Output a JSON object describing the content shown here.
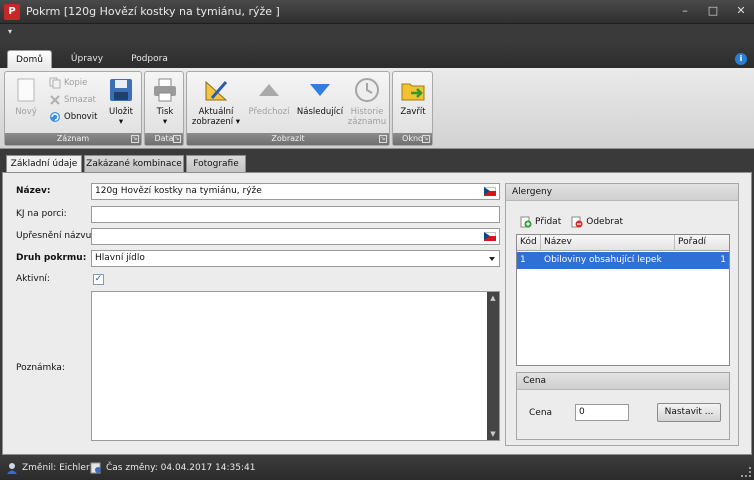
{
  "window": {
    "title": "Pokrm [120g Hovězí kostky na tymiánu, rýže ]",
    "app_icon": "app-logo-icon",
    "controls": [
      "–",
      "□",
      "✕"
    ]
  },
  "quick_access": {
    "menu_glyph": "▾"
  },
  "ribbon_tabs": [
    "Domů",
    "Úpravy",
    "Podpora"
  ],
  "active_tab": "Domů",
  "help_glyph": "i",
  "ribbon": {
    "zaznam": {
      "label": "Záznam",
      "new": "Nový",
      "copy": "Kopie",
      "delete": "Smazat",
      "refresh": "Obnovit",
      "save": "Uložit",
      "save_arrow": "▾"
    },
    "data": {
      "label": "Data",
      "print": "Tisk",
      "print_arrow": "▾"
    },
    "zobrazit": {
      "label": "Zobrazit",
      "current_view_1": "Aktuální",
      "current_view_2": "zobrazení ▾",
      "previous": "Předchozí",
      "next": "Následující",
      "history_1": "Historie",
      "history_2": "záznamu"
    },
    "okno": {
      "label": "Okno",
      "close": "Zavřít"
    },
    "launcher_glyph": "↘"
  },
  "page_tabs": [
    "Základní údaje",
    "Zakázané kombinace",
    "Fotografie"
  ],
  "active_page_tab": "Základní údaje",
  "form": {
    "name_label": "Název:",
    "name_value": "120g Hovězí kostky na tymiánu, rýže",
    "kj_label": "KJ na porci:",
    "kj_value": "",
    "refinement_label": "Upřesnění názvu:",
    "refinement_value": "",
    "type_label": "Druh pokrmu:",
    "type_value": "Hlavní jídlo",
    "active_label": "Aktivní:",
    "active_checked": true,
    "check_glyph": "✓",
    "note_label": "Poznámka:",
    "note_value": "",
    "scroll_up": "▲",
    "scroll_down": "▼"
  },
  "allergens": {
    "title": "Alergeny",
    "add": "Přidat",
    "remove": "Odebrat",
    "columns": [
      "Kód",
      "Název",
      "Pořadí"
    ],
    "rows": [
      {
        "code": "1",
        "name": "Obiloviny obsahující lepek",
        "order": "1"
      }
    ]
  },
  "price": {
    "title": "Cena",
    "label": "Cena",
    "value": "0",
    "set_button": "Nastavit ..."
  },
  "status": {
    "changed_by": "Změnil: Eichler",
    "changed_at": "Čas změny: 04.04.2017 14:35:41"
  },
  "colors": {
    "selection": "#2f6fd6",
    "titlebar": "#3a3a3a",
    "flag_red": "#d7141a",
    "flag_blue": "#11457e"
  }
}
